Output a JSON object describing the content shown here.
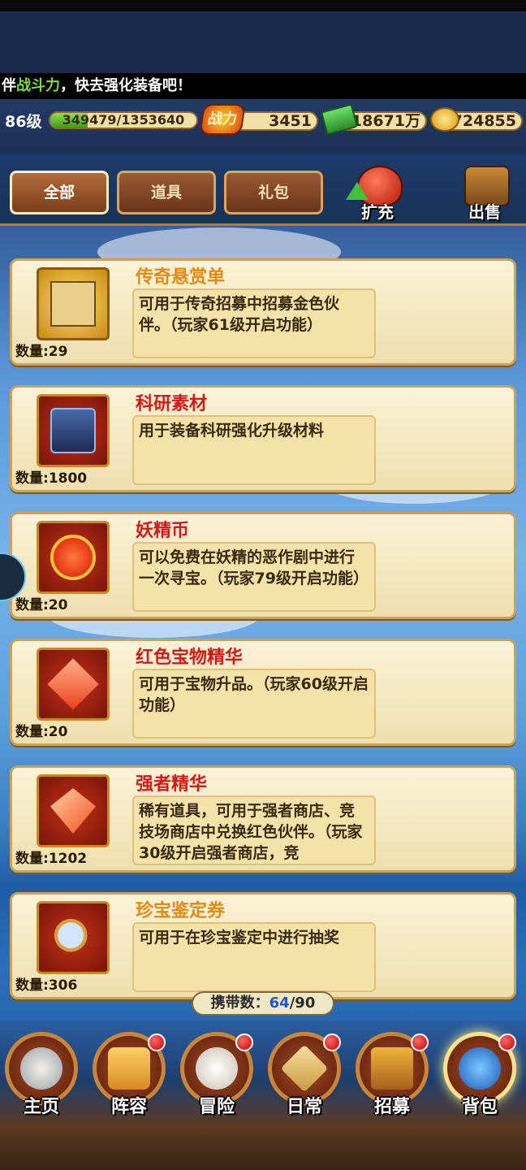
{
  "ticker": {
    "prefix": "伴",
    "highlight": "战斗力",
    "suffix": "，快去强化装备吧！"
  },
  "status": {
    "level": "86级",
    "exp_text": "349479/1353640",
    "exp_progress": 0.258,
    "power_label": "战力",
    "power_value": "3451",
    "cash_value": "18671万",
    "gold_value": "724855"
  },
  "tabs": [
    {
      "label": "全部",
      "active": true
    },
    {
      "label": "道具",
      "active": false
    },
    {
      "label": "礼包",
      "active": false
    }
  ],
  "actions": {
    "expand": "扩充",
    "sell": "出售"
  },
  "items": [
    {
      "name": "传奇悬赏单",
      "name_color": "#e08a10",
      "desc": "可用于传奇招募中招募金色伙伴。（玩家61级开启功能）",
      "qty": "数量:29",
      "icon": "wanted-poster-icon"
    },
    {
      "name": "科研素材",
      "name_color": "#d21a1a",
      "desc": "用于装备科研强化升级材料",
      "qty": "数量:1800",
      "icon": "research-material-icon"
    },
    {
      "name": "妖精币",
      "name_color": "#d21a1a",
      "desc": "可以免费在妖精的恶作剧中进行一次寻宝。（玩家79级开启功能）",
      "qty": "数量:20",
      "icon": "fairy-coin-icon"
    },
    {
      "name": "红色宝物精华",
      "name_color": "#d21a1a",
      "desc": "可用于宝物升品。（玩家60级开启功能）",
      "qty": "数量:20",
      "icon": "red-crystal-icon"
    },
    {
      "name": "强者精华",
      "name_color": "#d21a1a",
      "desc": "稀有道具，可用于强者商店、竞技场商店中兑换红色伙伴。（玩家30级开启强者商店，竞",
      "qty": "数量:1202",
      "icon": "red-gem-icon"
    },
    {
      "name": "珍宝鉴定券",
      "name_color": "#e08a10",
      "desc": "可用于在珍宝鉴定中进行抽奖",
      "qty": "数量:306",
      "icon": "magnifier-icon"
    }
  ],
  "capacity": {
    "label": "携带数：",
    "current": "64",
    "total": "/90"
  },
  "nav": [
    {
      "label": "主页",
      "icon": "home-icon",
      "dot": false
    },
    {
      "label": "阵容",
      "icon": "lineup-icon",
      "dot": true
    },
    {
      "label": "冒险",
      "icon": "skull-flag-icon",
      "dot": true
    },
    {
      "label": "日常",
      "icon": "swords-icon",
      "dot": true
    },
    {
      "label": "招募",
      "icon": "tavern-icon",
      "dot": true
    },
    {
      "label": "背包",
      "icon": "bag-icon",
      "dot": true
    }
  ]
}
